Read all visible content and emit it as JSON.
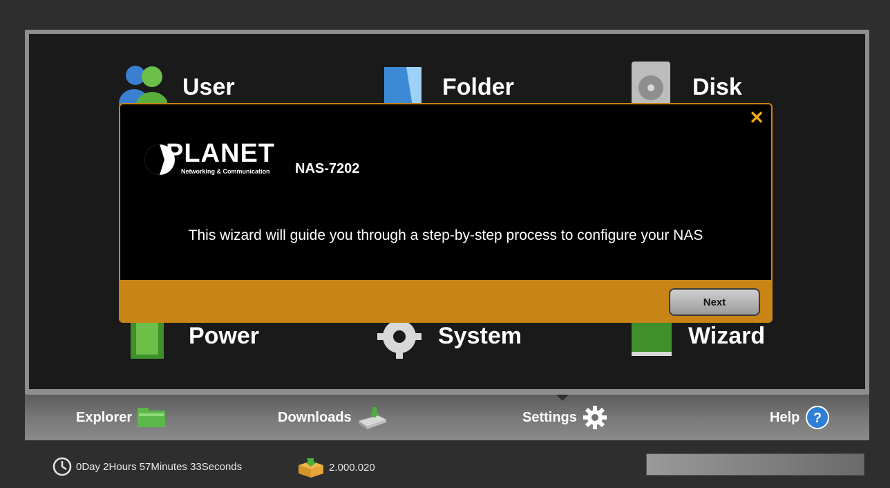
{
  "apps": {
    "user": {
      "label": "User",
      "icon": "users-icon"
    },
    "folder": {
      "label": "Folder",
      "icon": "folder-icon"
    },
    "disk": {
      "label": "Disk",
      "icon": "hard-disk-icon"
    },
    "power": {
      "label": "Power",
      "icon": "power-battery-icon"
    },
    "system": {
      "label": "System",
      "icon": "gear-icon"
    },
    "wizard": {
      "label": "Wizard",
      "icon": "wizard-icon"
    }
  },
  "toolbar": {
    "explorer": {
      "label": "Explorer",
      "icon": "folder-icon"
    },
    "downloads": {
      "label": "Downloads",
      "icon": "download-drive-icon"
    },
    "settings": {
      "label": "Settings",
      "icon": "gear-icon"
    },
    "help": {
      "label": "Help",
      "icon": "help-icon"
    }
  },
  "status": {
    "uptime": "0Day 2Hours 57Minutes 33Seconds",
    "firmware": "2.000.020"
  },
  "modal": {
    "brand": "PLANET",
    "tagline": "Networking & Communication",
    "model": "NAS-7202",
    "message": "This wizard will guide you through a step-by-step process to configure your NAS",
    "next_label": "Next",
    "close_symbol": "✕"
  },
  "colors": {
    "accent": "#c98416",
    "panel": "#1a1a1a",
    "background": "#2e2e2e"
  }
}
